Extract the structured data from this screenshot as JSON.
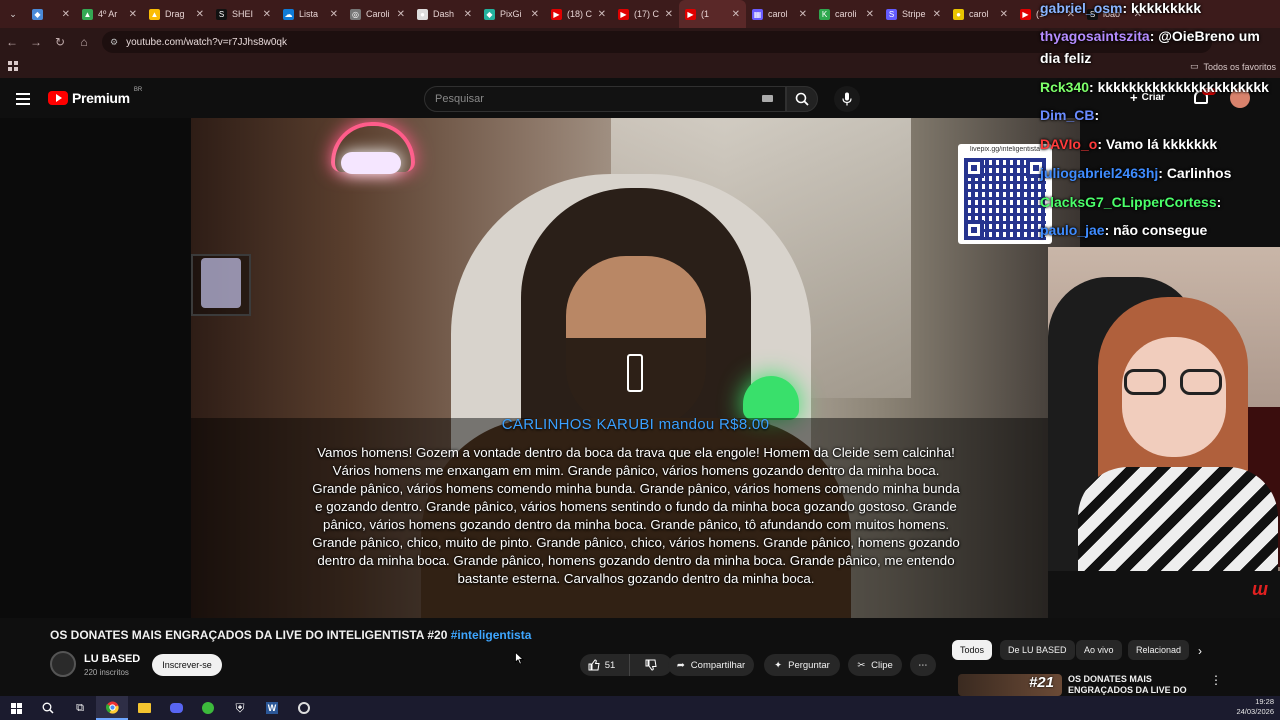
{
  "browser": {
    "tabs": [
      {
        "label": "",
        "favicon_color": "#4a8ad8",
        "favicon": "◆"
      },
      {
        "label": "4º Ar",
        "favicon_color": "#34a853",
        "favicon": "▲"
      },
      {
        "label": "Drag",
        "favicon_color": "#fbbc04",
        "favicon": "▲"
      },
      {
        "label": "SHEI",
        "favicon_color": "#111111",
        "favicon": "S"
      },
      {
        "label": "Lista",
        "favicon_color": "#0f7bd8",
        "favicon": "☁"
      },
      {
        "label": "Caroli",
        "favicon_color": "#777777",
        "favicon": "◎"
      },
      {
        "label": "Dash",
        "favicon_color": "#dddddd",
        "favicon": "●"
      },
      {
        "label": "PixGi",
        "favicon_color": "#23b19d",
        "favicon": "◆"
      },
      {
        "label": "(18) C",
        "favicon_color": "#e00000",
        "favicon": "▶"
      },
      {
        "label": "(17) C",
        "favicon_color": "#e00000",
        "favicon": "▶"
      },
      {
        "label": "(1",
        "favicon_color": "#e00000",
        "favicon": "▶",
        "active": true
      },
      {
        "label": "carol",
        "favicon_color": "#6a5cff",
        "favicon": "▦"
      },
      {
        "label": "caroli",
        "favicon_color": "#2fa84f",
        "favicon": "K"
      },
      {
        "label": "Stripe",
        "favicon_color": "#635bff",
        "favicon": "S"
      },
      {
        "label": "carol",
        "favicon_color": "#e8c400",
        "favicon": "●"
      },
      {
        "label": "(1",
        "favicon_color": "#e00000",
        "favicon": "▶"
      },
      {
        "label": "ioao",
        "favicon_color": "#111111",
        "favicon": "S"
      }
    ],
    "url": "youtube.com/watch?v=r7JJhs8w0qk",
    "all_favorites": "Todos os favoritos"
  },
  "youtube": {
    "logo_text": "Premium",
    "logo_sup": "BR",
    "search_placeholder": "Pesquisar",
    "create_label": "Criar",
    "notif_count": "9+"
  },
  "video": {
    "donor_line": "CARLINHOS KARUBI mandou R$8.00",
    "message": "Vamos homens! Gozem a vontade dentro da boca da trava que ela engole! Homem da Cleide sem calcinha! Vários homens me enxangam em mim. Grande pânico, vários homens gozando dentro da minha boca. Grande pânico, vários homens comendo minha bunda. Grande pânico, vários homens comendo minha bunda e gozando dentro. Grande pânico, vários homens sentindo o fundo da minha boca gozando gostoso. Grande pânico, vários homens gozando dentro da minha boca. Grande pânico, tô afundando com muitos homens. Grande pânico, chico, muito de pinto. Grande pânico, chico, vários homens. Grande pânico, homens gozando dentro da minha boca. Grande pânico, homens gozando dentro da minha boca. Grande pânico, me entendo bastante esterna. Carvalhos gozando dentro da minha boca.",
    "qr_url": "livepix.gg/inteligentista"
  },
  "chat": [
    {
      "user": "gabriel_osm",
      "text": ": kkkkkkkkk",
      "color": "#8ab4ff"
    },
    {
      "user": "thyagosaintszita",
      "text": ": @OieBreno um",
      "color": "#b58cff"
    },
    {
      "user": "",
      "text": "dia feliz",
      "color": "#ffffff"
    },
    {
      "user": "Rck340",
      "text": ": kkkkkkkkkkkkkkkkkkkkkk",
      "color": "#7dff6a"
    },
    {
      "user": "Dim_CB",
      "text": ":",
      "color": "#6a8cff"
    },
    {
      "user": "DAVIo_o",
      "text": ": Vamo lá kkkkkkk",
      "color": "#ff3b3b"
    },
    {
      "user": "juliogabriel2463hj",
      "text": ": Carlinhos",
      "color": "#3f8cff"
    },
    {
      "user": "ClacksG7_CLipperCortess",
      "text": ":",
      "color": "#4bff6a"
    },
    {
      "user": "paulo_jae",
      "text": ": não consegue",
      "color": "#3f8cff"
    }
  ],
  "below": {
    "title": "OS DONATES MAIS ENGRAÇADOS DA LIVE DO INTELIGENTISTA #20",
    "hashtag": "#inteligentista",
    "channel": "LU BASED",
    "subs": "220 inscritos",
    "subscribe": "Inscrever-se",
    "likes": "51",
    "share": "Compartilhar",
    "ask": "Perguntar",
    "clip": "Clipe",
    "chips": [
      "Todos",
      "De LU BASED",
      "Ao vivo",
      "Relacionad"
    ],
    "rec_title": "OS DONATES MAIS ENGRAÇADOS DA LIVE DO",
    "rec_number": "#21"
  },
  "taskbar": {
    "time": "19:28",
    "date": "24/03/2026"
  }
}
